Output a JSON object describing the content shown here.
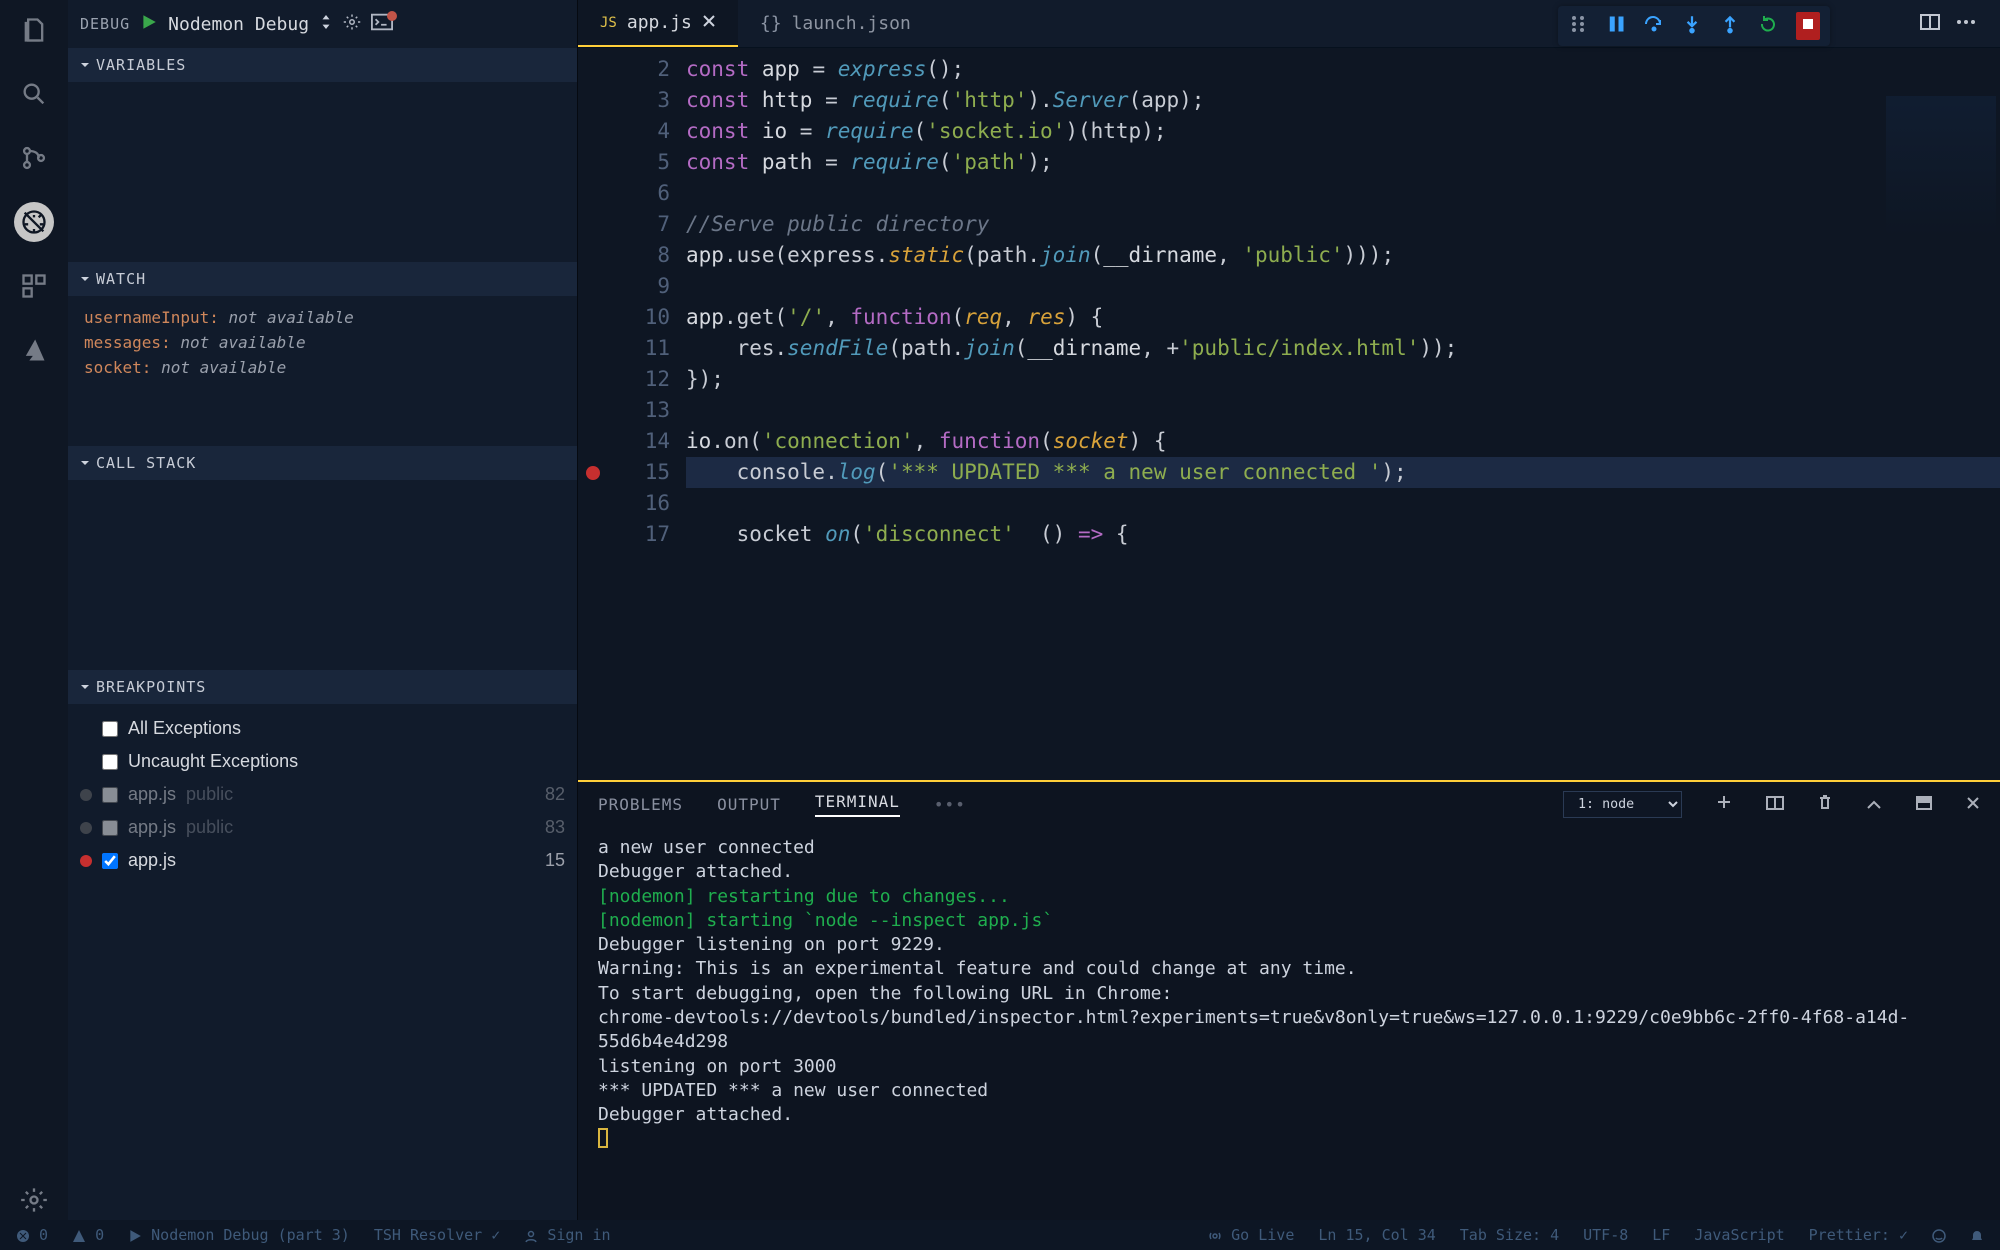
{
  "activity": {
    "items": [
      "files",
      "search",
      "scm",
      "debug",
      "extensions",
      "azure"
    ]
  },
  "debug": {
    "label": "DEBUG",
    "config": "Nodemon Debug",
    "sections": {
      "variables": "VARIABLES",
      "watch": "WATCH",
      "callstack": "CALL STACK",
      "breakpoints": "BREAKPOINTS"
    },
    "watch": [
      {
        "name": "usernameInput:",
        "value": "not available"
      },
      {
        "name": "messages:",
        "value": "not available"
      },
      {
        "name": "socket:",
        "value": "not available"
      }
    ],
    "breakpoints": {
      "allExceptions": "All Exceptions",
      "uncaught": "Uncaught Exceptions",
      "rows": [
        {
          "file": "app.js",
          "loc": "public",
          "line": "82",
          "active": false
        },
        {
          "file": "app.js",
          "loc": "public",
          "line": "83",
          "active": false
        },
        {
          "file": "app.js",
          "loc": "",
          "line": "15",
          "active": true
        }
      ]
    }
  },
  "tabs": [
    {
      "icon": "JS",
      "name": "app.js",
      "active": true,
      "close": true
    },
    {
      "icon": "{}",
      "name": "launch.json",
      "active": false,
      "close": false
    }
  ],
  "code": {
    "start": 2,
    "lines": [
      {
        "n": 2,
        "h": [
          [
            "kw",
            "const "
          ],
          [
            "id",
            "app "
          ],
          [
            "",
            "= "
          ],
          [
            "fn",
            "express"
          ],
          [
            "",
            "();"
          ]
        ]
      },
      {
        "n": 3,
        "h": [
          [
            "kw",
            "const "
          ],
          [
            "id",
            "http "
          ],
          [
            "",
            "= "
          ],
          [
            "fn",
            "require"
          ],
          [
            "",
            "("
          ],
          [
            "str",
            "'http'"
          ],
          [
            "",
            ")."
          ],
          [
            "fn",
            "Server"
          ],
          [
            "",
            "(app);"
          ]
        ]
      },
      {
        "n": 4,
        "h": [
          [
            "kw",
            "const "
          ],
          [
            "id",
            "io "
          ],
          [
            "",
            "= "
          ],
          [
            "fn",
            "require"
          ],
          [
            "",
            "("
          ],
          [
            "str",
            "'socket.io'"
          ],
          [
            "",
            ")(http);"
          ]
        ]
      },
      {
        "n": 5,
        "h": [
          [
            "kw",
            "const "
          ],
          [
            "id",
            "path "
          ],
          [
            "",
            "= "
          ],
          [
            "fn",
            "require"
          ],
          [
            "",
            "("
          ],
          [
            "str",
            "'path'"
          ],
          [
            "",
            ");"
          ]
        ]
      },
      {
        "n": 6,
        "h": []
      },
      {
        "n": 7,
        "h": [
          [
            "cm",
            "//Serve public directory"
          ]
        ]
      },
      {
        "n": 8,
        "h": [
          [
            "id",
            "app"
          ],
          [
            "",
            ".use(express."
          ],
          [
            "pr",
            "static"
          ],
          [
            "",
            "(path."
          ],
          [
            "fn",
            "join"
          ],
          [
            "",
            "("
          ],
          [
            "id",
            "__dirname"
          ],
          [
            "",
            ", "
          ],
          [
            "str",
            "'public'"
          ],
          [
            "",
            ")));"
          ]
        ]
      },
      {
        "n": 9,
        "h": []
      },
      {
        "n": 10,
        "h": [
          [
            "id",
            "app"
          ],
          [
            "",
            ".get("
          ],
          [
            "str",
            "'/'"
          ],
          [
            "",
            ", "
          ],
          [
            "kw",
            "function"
          ],
          [
            "",
            "("
          ],
          [
            "pr",
            "req"
          ],
          [
            "",
            ", "
          ],
          [
            "pr",
            "res"
          ],
          [
            "",
            ") {"
          ]
        ]
      },
      {
        "n": 11,
        "h": [
          [
            "",
            "    res."
          ],
          [
            "fn",
            "sendFile"
          ],
          [
            "",
            "(path."
          ],
          [
            "fn",
            "join"
          ],
          [
            "",
            "("
          ],
          [
            "id",
            "__dirname"
          ],
          [
            "",
            ", +"
          ],
          [
            "str",
            "'public/index.html'"
          ],
          [
            "",
            "));"
          ]
        ]
      },
      {
        "n": 12,
        "h": [
          [
            "",
            "});"
          ]
        ]
      },
      {
        "n": 13,
        "h": []
      },
      {
        "n": 14,
        "h": [
          [
            "id",
            "io"
          ],
          [
            "",
            ".on("
          ],
          [
            "str",
            "'connection'"
          ],
          [
            "",
            ", "
          ],
          [
            "kw",
            "function"
          ],
          [
            "",
            "("
          ],
          [
            "pr",
            "socket"
          ],
          [
            "",
            ") {"
          ]
        ]
      },
      {
        "n": 15,
        "bp": true,
        "hl": true,
        "h": [
          [
            "",
            "    console."
          ],
          [
            "fn",
            "log"
          ],
          [
            "",
            "("
          ],
          [
            "str",
            "'*** UPDATED *** a new user connected '"
          ],
          [
            "",
            ");"
          ]
        ]
      },
      {
        "n": 16,
        "h": []
      },
      {
        "n": 17,
        "h": [
          [
            "",
            "    socket "
          ],
          [
            "fn",
            "on"
          ],
          [
            "",
            "("
          ],
          [
            "str",
            "'disconnect'"
          ],
          [
            "",
            "  () "
          ],
          [
            "kw",
            "=>"
          ],
          [
            "",
            ""
          ],
          [
            "",
            ""
          ],
          [
            "",
            ""
          ],
          [
            "",
            ""
          ],
          " {"
        ]
      }
    ]
  },
  "panel": {
    "tabs": {
      "problems": "PROBLEMS",
      "output": "OUTPUT",
      "terminal": "TERMINAL"
    },
    "termselect": "1: node",
    "lines": [
      {
        "c": "",
        "t": "a new user connected"
      },
      {
        "c": "",
        "t": "Debugger attached."
      },
      {
        "c": "g",
        "t": "[nodemon] restarting due to changes..."
      },
      {
        "c": "g",
        "t": "[nodemon] starting `node --inspect app.js`"
      },
      {
        "c": "",
        "t": "Debugger listening on port 9229."
      },
      {
        "c": "",
        "t": "Warning: This is an experimental feature and could change at any time."
      },
      {
        "c": "",
        "t": "To start debugging, open the following URL in Chrome:"
      },
      {
        "c": "",
        "t": "    chrome-devtools://devtools/bundled/inspector.html?experiments=true&v8only=true&ws=127.0.0.1:9229/c0e9bb6c-2ff0-4f68-a14d-55d6b4e4d298"
      },
      {
        "c": "",
        "t": "listening on port 3000"
      },
      {
        "c": "",
        "t": "*** UPDATED *** a new user connected"
      },
      {
        "c": "",
        "t": "Debugger attached."
      }
    ]
  },
  "status": {
    "errors": "0",
    "warnings": "0",
    "debug": "Nodemon Debug (part 3)",
    "resolver": "TSH Resolver ✓",
    "signin": "Sign in",
    "golive": "Go Live",
    "pos": "Ln 15, Col 34",
    "tab": "Tab Size: 4",
    "enc": "UTF-8",
    "eol": "LF",
    "lang": "JavaScript",
    "prettier": "Prettier: ✓"
  }
}
